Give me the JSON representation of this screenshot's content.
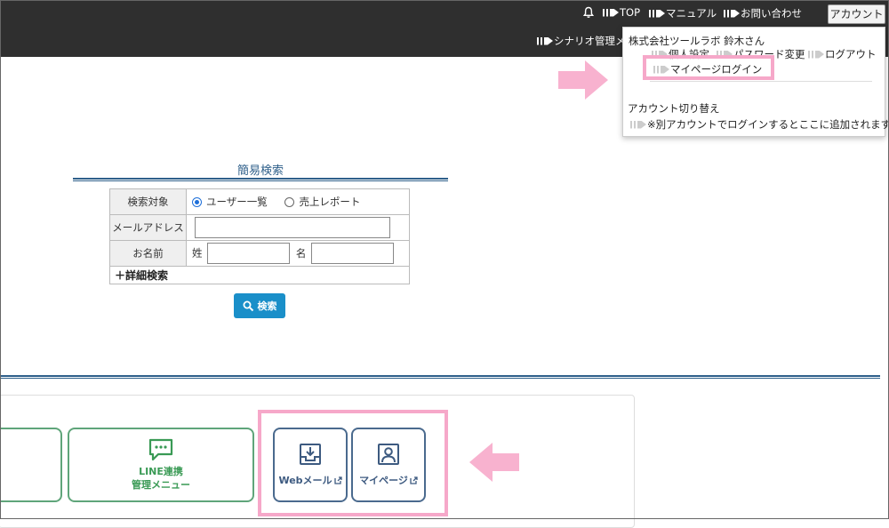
{
  "header": {
    "links": [
      "TOP",
      "マニュアル",
      "お問い合わせ"
    ],
    "account_button": "アカウント",
    "scenario_link": "シナリオ管理メ"
  },
  "dropdown": {
    "company_user": "株式会社ツールラボ 鈴木さん",
    "personal_settings": "個人設定",
    "password_change": "パスワード変更",
    "logout": "ログアウト",
    "mypage_login": "マイページログイン",
    "switch_title": "アカウント切り替え",
    "switch_note": "※別アカウントでログインするとここに追加されます"
  },
  "search": {
    "title": "簡易検索",
    "rows": {
      "target_label": "検索対象",
      "radio_users": "ユーザー一覧",
      "radio_sales": "売上レポート",
      "email_label": "メールアドレス",
      "name_label": "お名前",
      "last_name": "姓",
      "first_name": "名",
      "advanced": "＋詳細検索"
    },
    "button": "検索"
  },
  "cards": {
    "line_line1": "LINE連携",
    "line_line2": "管理メニュー",
    "webmail": "Webメール",
    "mypage": "マイページ"
  },
  "colors": {
    "topbar": "#2f2f2f",
    "highlight": "#f6a8c9",
    "accent_blue": "#2e5f8a",
    "search_button": "#1a8fc9",
    "card_green": "#5fa57a",
    "card_blue": "#4a6a8e"
  }
}
